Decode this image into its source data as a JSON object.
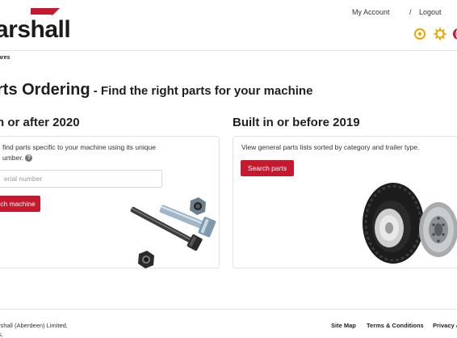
{
  "header": {
    "logo_text": "arshall",
    "my_account": "My Account",
    "separator": "/",
    "logout": "Logout",
    "icons": [
      "target-icon",
      "gear-icon",
      "globe-icon"
    ],
    "accent_color": "#c4192f",
    "icon_color": "#f0a500"
  },
  "breadcrumb": {
    "current": "ares"
  },
  "page": {
    "title": "rts Ordering",
    "subtitle": " - Find the right parts for your machine"
  },
  "left_section": {
    "title": "n or after 2020",
    "description_line1": "find parts specific to your machine using its unique",
    "description_line2": "umber.",
    "help_icon": "?",
    "input_placeholder": "erial number",
    "button_label": "ch machine",
    "image": "bolts-and-nuts"
  },
  "right_section": {
    "title": "Built in or before 2019",
    "description": "View general parts lists sorted by category and trailer type.",
    "button_label": "Search parts",
    "image": "trailer-wheels"
  },
  "footer": {
    "company_line1": "rshall (Aberdeen) Limited,",
    "company_line2": "s,",
    "links": [
      "Site Map",
      "Terms & Conditions",
      "Privacy &"
    ]
  }
}
